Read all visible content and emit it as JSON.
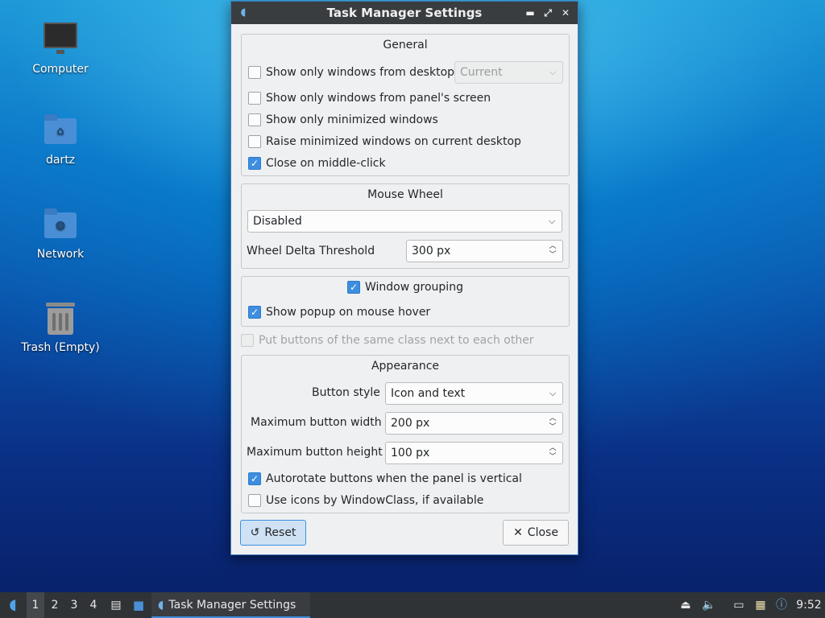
{
  "desktop": {
    "icons": [
      {
        "label": "Computer"
      },
      {
        "label": "dartz"
      },
      {
        "label": "Network"
      },
      {
        "label": "Trash (Empty)"
      }
    ]
  },
  "dialog": {
    "title": "Task Manager Settings",
    "general": {
      "title": "General",
      "show_only_desktop": {
        "label": "Show only windows from desktop",
        "checked": false
      },
      "desktop_select": {
        "value": "Current",
        "disabled": true
      },
      "show_only_panel_screen": {
        "label": "Show only windows from panel's screen",
        "checked": false
      },
      "show_only_minimized": {
        "label": "Show only minimized windows",
        "checked": false
      },
      "raise_minimized": {
        "label": "Raise minimized windows on current desktop",
        "checked": false
      },
      "close_middle_click": {
        "label": "Close on middle-click",
        "checked": true
      }
    },
    "mouse_wheel": {
      "title": "Mouse Wheel",
      "mode": "Disabled",
      "threshold_label": "Wheel Delta Threshold",
      "threshold_value": "300 px"
    },
    "grouping": {
      "window_grouping": {
        "label": "Window grouping",
        "checked": true
      },
      "show_popup": {
        "label": "Show popup on mouse hover",
        "checked": true
      }
    },
    "same_class": {
      "label": "Put buttons of the same class next to each other",
      "checked": false,
      "disabled": true
    },
    "appearance": {
      "title": "Appearance",
      "button_style_label": "Button style",
      "button_style_value": "Icon and text",
      "max_width_label": "Maximum button width",
      "max_width_value": "200 px",
      "max_height_label": "Maximum button height",
      "max_height_value": "100 px",
      "autorotate": {
        "label": "Autorotate buttons when the panel is vertical",
        "checked": true
      },
      "use_icons": {
        "label": "Use icons by WindowClass, if available",
        "checked": false
      }
    },
    "buttons": {
      "reset": "Reset",
      "close": "Close"
    }
  },
  "taskbar": {
    "desktops": [
      "1",
      "2",
      "3",
      "4"
    ],
    "active_desktop": "1",
    "task_label": "Task Manager Settings",
    "clock": "9:52"
  },
  "colors": {
    "accent": "#3d8ee0",
    "titlebar": "#3a3d40",
    "taskbar": "#303336"
  }
}
